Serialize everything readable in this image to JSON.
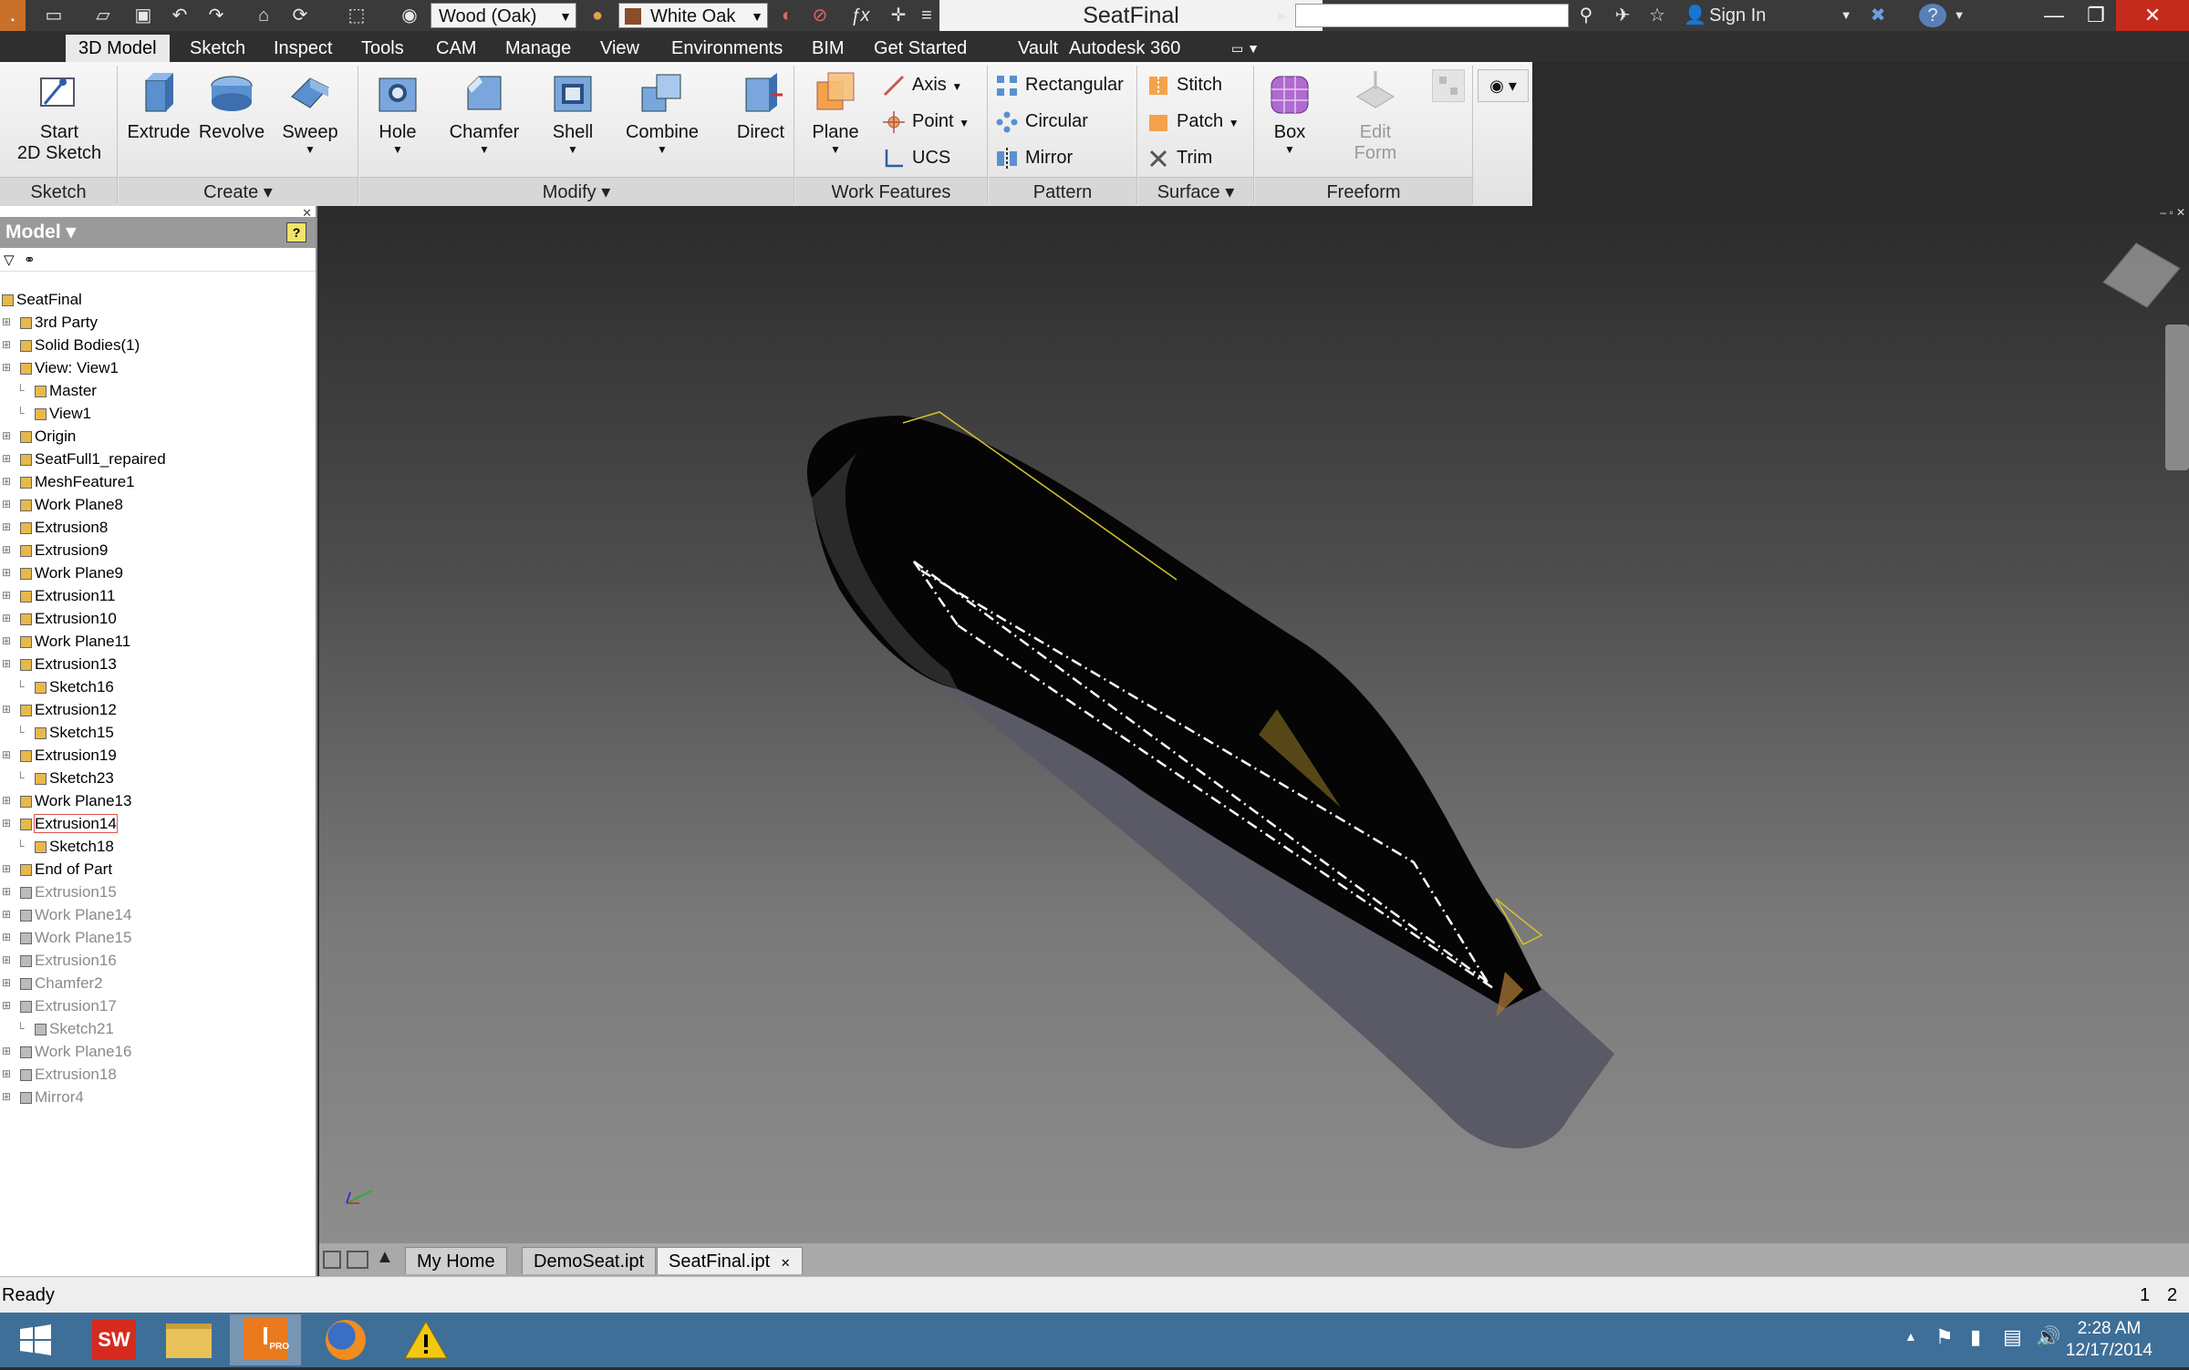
{
  "window": {
    "title": "SeatFinal",
    "sign_in": "Sign In",
    "material": "Wood (Oak)",
    "appearance": "White Oak"
  },
  "tabs": [
    "3D Model",
    "Sketch",
    "Inspect",
    "Tools",
    "CAM",
    "Manage",
    "View",
    "Environments",
    "BIM",
    "Get Started",
    "Vault",
    "Autodesk 360"
  ],
  "ribbon": {
    "start_sketch": "Start\n2D Sketch",
    "start_sketch_l1": "Start",
    "start_sketch_l2": "2D Sketch",
    "extrude": "Extrude",
    "revolve": "Revolve",
    "sweep": "Sweep",
    "hole": "Hole",
    "chamfer": "Chamfer",
    "shell": "Shell",
    "combine": "Combine",
    "direct": "Direct",
    "plane": "Plane",
    "axis": "Axis",
    "point": "Point",
    "ucs": "UCS",
    "rectangular": "Rectangular",
    "circular": "Circular",
    "mirror": "Mirror",
    "stitch": "Stitch",
    "patch": "Patch",
    "trim": "Trim",
    "box": "Box",
    "edit_form_l1": "Edit",
    "edit_form_l2": "Form",
    "groups": {
      "sketch": "Sketch",
      "create": "Create",
      "modify": "Modify",
      "work_features": "Work Features",
      "pattern": "Pattern",
      "surface": "Surface",
      "freeform": "Freeform"
    }
  },
  "browser": {
    "title": "Model",
    "nodes": [
      {
        "label": "SeatFinal",
        "depth": 0,
        "state": "normal"
      },
      {
        "label": "3rd Party",
        "depth": 1,
        "state": "normal"
      },
      {
        "label": "Solid Bodies(1)",
        "depth": 1,
        "state": "normal"
      },
      {
        "label": "View: View1",
        "depth": 1,
        "state": "normal"
      },
      {
        "label": "Master",
        "depth": 2,
        "state": "normal"
      },
      {
        "label": "View1",
        "depth": 2,
        "state": "normal"
      },
      {
        "label": "Origin",
        "depth": 1,
        "state": "normal"
      },
      {
        "label": "SeatFull1_repaired",
        "depth": 1,
        "state": "normal"
      },
      {
        "label": "MeshFeature1",
        "depth": 1,
        "state": "normal"
      },
      {
        "label": "Work Plane8",
        "depth": 1,
        "state": "normal"
      },
      {
        "label": "Extrusion8",
        "depth": 1,
        "state": "normal"
      },
      {
        "label": "Extrusion9",
        "depth": 1,
        "state": "normal"
      },
      {
        "label": "Work Plane9",
        "depth": 1,
        "state": "normal"
      },
      {
        "label": "Extrusion11",
        "depth": 1,
        "state": "normal"
      },
      {
        "label": "Extrusion10",
        "depth": 1,
        "state": "normal"
      },
      {
        "label": "Work Plane11",
        "depth": 1,
        "state": "normal"
      },
      {
        "label": "Extrusion13",
        "depth": 1,
        "state": "normal"
      },
      {
        "label": "Sketch16",
        "depth": 2,
        "state": "normal"
      },
      {
        "label": "Extrusion12",
        "depth": 1,
        "state": "normal"
      },
      {
        "label": "Sketch15",
        "depth": 2,
        "state": "normal"
      },
      {
        "label": "Extrusion19",
        "depth": 1,
        "state": "normal"
      },
      {
        "label": "Sketch23",
        "depth": 2,
        "state": "normal"
      },
      {
        "label": "Work Plane13",
        "depth": 1,
        "state": "normal"
      },
      {
        "label": "Extrusion14",
        "depth": 1,
        "state": "selected"
      },
      {
        "label": "Sketch18",
        "depth": 2,
        "state": "normal"
      },
      {
        "label": "End of Part",
        "depth": 1,
        "state": "normal"
      },
      {
        "label": "Extrusion15",
        "depth": 1,
        "state": "suppressed"
      },
      {
        "label": "Work Plane14",
        "depth": 1,
        "state": "suppressed"
      },
      {
        "label": "Work Plane15",
        "depth": 1,
        "state": "suppressed"
      },
      {
        "label": "Extrusion16",
        "depth": 1,
        "state": "suppressed"
      },
      {
        "label": "Chamfer2",
        "depth": 1,
        "state": "suppressed"
      },
      {
        "label": "Extrusion17",
        "depth": 1,
        "state": "suppressed"
      },
      {
        "label": "Sketch21",
        "depth": 2,
        "state": "suppressed"
      },
      {
        "label": "Work Plane16",
        "depth": 1,
        "state": "suppressed"
      },
      {
        "label": "Extrusion18",
        "depth": 1,
        "state": "suppressed"
      },
      {
        "label": "Mirror4",
        "depth": 1,
        "state": "suppressed"
      }
    ]
  },
  "doc_tabs": [
    "My Home",
    "DemoSeat.ipt",
    "SeatFinal.ipt"
  ],
  "status": {
    "text": "Ready",
    "count1": "1",
    "count2": "2"
  },
  "clock": {
    "time": "2:28 AM",
    "date": "12/17/2014"
  },
  "taskbar": {
    "pro_badge": "PRO"
  },
  "colors": {
    "title_bar": "#3a3a3a",
    "ribbon_bg": "#efefef",
    "taskbar": "#3e6f99",
    "selected_outline": "#d9534f"
  }
}
